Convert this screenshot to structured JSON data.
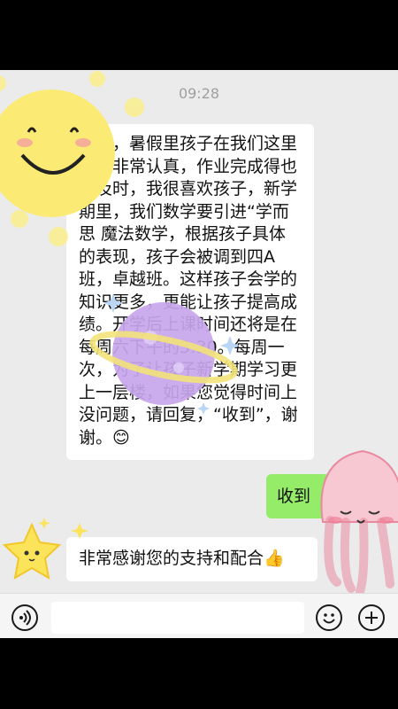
{
  "status": {
    "time": "09:28"
  },
  "messages": {
    "incoming_main": "妈妈，暑假里孩子在我们这里上课非常认真，作业完成得也很及时，我很喜欢孩子，新学期里，我们数学要引进“学而思 魔法数学，根据孩子具体的表现，孩子会被调到四A班，卓越班。这样孩子会学的知识更多，更能让孩子提高成绩。开学后上课时间还将是在每周六下午的3:30。每周一次，为了让孩子新学期学习更上一层楼，如果您觉得时间上没问题，请回复，“收到”，谢谢。😊",
    "outgoing": "收到",
    "incoming_thanks": "非常感谢您的支持和配合👍"
  },
  "input_bar": {
    "voice_icon": "voice-icon",
    "emoji_icon": "emoji-icon",
    "add_icon": "plus-icon"
  },
  "colors": {
    "chat_bg": "#ebebeb",
    "outgoing_bubble": "#95ec69",
    "incoming_bubble": "#ffffff"
  }
}
